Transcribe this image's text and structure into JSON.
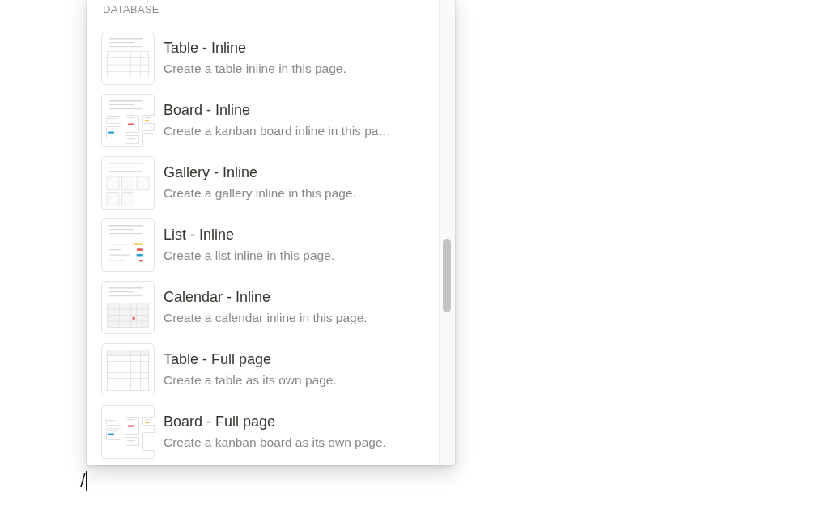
{
  "editor": {
    "typed_text": "/"
  },
  "menu": {
    "section_title": "DATABASE",
    "items": [
      {
        "kind": "table_inline",
        "title": "Table - Inline",
        "description": "Create a table inline in this page.",
        "selected": false
      },
      {
        "kind": "board_inline",
        "title": "Board - Inline",
        "description": "Create a kanban board inline in this pa…",
        "selected": false
      },
      {
        "kind": "gallery_inline",
        "title": "Gallery - Inline",
        "description": "Create a gallery inline in this page.",
        "selected": false
      },
      {
        "kind": "list_inline",
        "title": "List - Inline",
        "description": "Create a list inline in this page.",
        "selected": false
      },
      {
        "kind": "calendar_inline",
        "title": "Calendar - Inline",
        "description": "Create a calendar inline in this page.",
        "selected": false
      },
      {
        "kind": "table_full",
        "title": "Table - Full page",
        "description": "Create a table as its own page.",
        "selected": false
      },
      {
        "kind": "board_full",
        "title": "Board - Full page",
        "description": "Create a kanban board as its own page.",
        "selected": false
      }
    ]
  }
}
